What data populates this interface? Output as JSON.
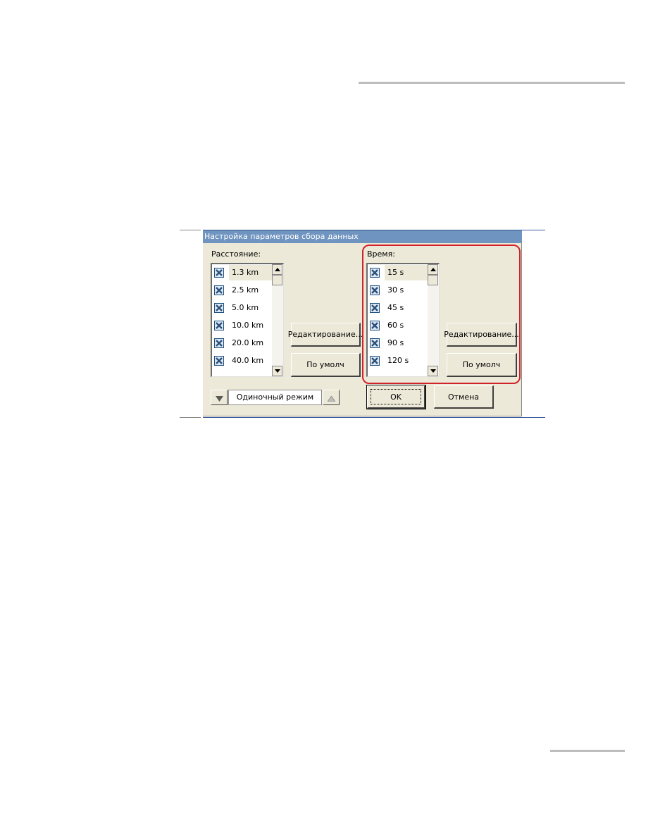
{
  "window": {
    "title": "Настройка параметров сбора данных"
  },
  "distance": {
    "label": "Расстояние:",
    "items": [
      "1.3 km",
      "2.5 km",
      "5.0 km",
      "10.0 km",
      "20.0 km",
      "40.0 km"
    ],
    "edit_button": "Редактирование...",
    "default_button": "По умолч"
  },
  "time": {
    "label": "Время:",
    "items": [
      "15 s",
      "30 s",
      "45 s",
      "60 s",
      "90 s",
      "120 s"
    ],
    "edit_button": "Редактирование...",
    "default_button": "По умолч"
  },
  "mode": {
    "value": "Одиночный режим"
  },
  "buttons": {
    "ok": "OK",
    "cancel": "Отмена"
  },
  "colors": {
    "title_bar": "#6f94bf",
    "highlight": "#d2232a",
    "dialog_bg": "#ece9d8"
  },
  "icons": {
    "checkbox": "checkbox-x-icon",
    "scroll_up": "arrow-up-icon",
    "scroll_down": "arrow-down-icon"
  }
}
